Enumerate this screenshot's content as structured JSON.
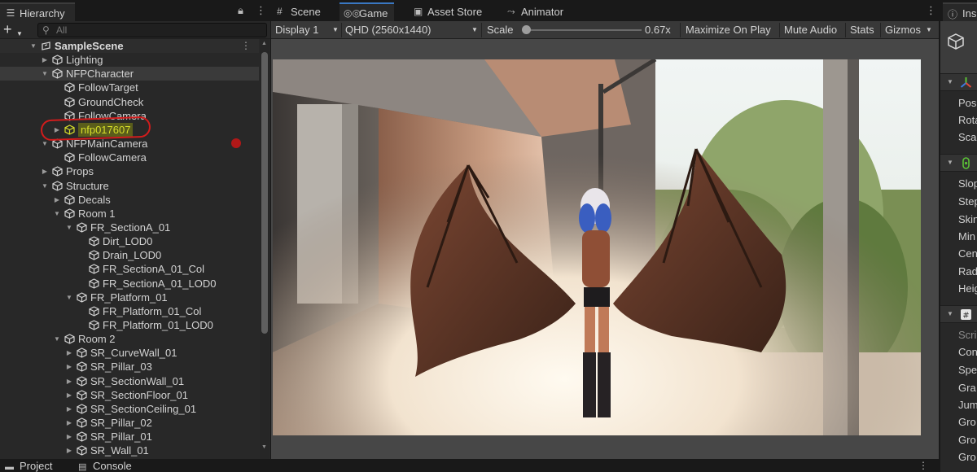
{
  "hierarchy": {
    "tab_label": "Hierarchy",
    "search_placeholder": "All",
    "lock_icon": "lock-icon",
    "menu_icon": "kebab-menu-icon",
    "rows": [
      {
        "label": "SampleScene",
        "depth": 0,
        "arrow": "open",
        "kind": "scene"
      },
      {
        "label": "Lighting",
        "depth": 1,
        "arrow": "closed",
        "kind": "object"
      },
      {
        "label": "NFPCharacter",
        "depth": 1,
        "arrow": "open",
        "kind": "object"
      },
      {
        "label": "FollowTarget",
        "depth": 2,
        "arrow": "none",
        "kind": "object"
      },
      {
        "label": "GroundCheck",
        "depth": 2,
        "arrow": "none",
        "kind": "object"
      },
      {
        "label": "FollowCamera",
        "depth": 2,
        "arrow": "none",
        "kind": "object"
      },
      {
        "label": "nfp017607",
        "depth": 2,
        "arrow": "closed",
        "kind": "prefab"
      },
      {
        "label": "NFPMainCamera",
        "depth": 1,
        "arrow": "open",
        "kind": "object"
      },
      {
        "label": "FollowCamera",
        "depth": 2,
        "arrow": "none",
        "kind": "object"
      },
      {
        "label": "Props",
        "depth": 1,
        "arrow": "closed",
        "kind": "object"
      },
      {
        "label": "Structure",
        "depth": 1,
        "arrow": "open",
        "kind": "object"
      },
      {
        "label": "Decals",
        "depth": 2,
        "arrow": "closed",
        "kind": "object"
      },
      {
        "label": "Room 1",
        "depth": 2,
        "arrow": "open",
        "kind": "object"
      },
      {
        "label": "FR_SectionA_01",
        "depth": 3,
        "arrow": "open",
        "kind": "object"
      },
      {
        "label": "Dirt_LOD0",
        "depth": 4,
        "arrow": "none",
        "kind": "object"
      },
      {
        "label": "Drain_LOD0",
        "depth": 4,
        "arrow": "none",
        "kind": "object"
      },
      {
        "label": "FR_SectionA_01_Col",
        "depth": 4,
        "arrow": "none",
        "kind": "object"
      },
      {
        "label": "FR_SectionA_01_LOD0",
        "depth": 4,
        "arrow": "none",
        "kind": "object"
      },
      {
        "label": "FR_Platform_01",
        "depth": 3,
        "arrow": "open",
        "kind": "object"
      },
      {
        "label": "FR_Platform_01_Col",
        "depth": 4,
        "arrow": "none",
        "kind": "object"
      },
      {
        "label": "FR_Platform_01_LOD0",
        "depth": 4,
        "arrow": "none",
        "kind": "object"
      },
      {
        "label": "Room 2",
        "depth": 2,
        "arrow": "open",
        "kind": "object"
      },
      {
        "label": "SR_CurveWall_01",
        "depth": 3,
        "arrow": "closed",
        "kind": "object"
      },
      {
        "label": "SR_Pillar_03",
        "depth": 3,
        "arrow": "closed",
        "kind": "object"
      },
      {
        "label": "SR_SectionWall_01",
        "depth": 3,
        "arrow": "closed",
        "kind": "object"
      },
      {
        "label": "SR_SectionFloor_01",
        "depth": 3,
        "arrow": "closed",
        "kind": "object"
      },
      {
        "label": "SR_SectionCeiling_01",
        "depth": 3,
        "arrow": "closed",
        "kind": "object"
      },
      {
        "label": "SR_Pillar_02",
        "depth": 3,
        "arrow": "closed",
        "kind": "object"
      },
      {
        "label": "SR_Pillar_01",
        "depth": 3,
        "arrow": "closed",
        "kind": "object"
      },
      {
        "label": "SR_Wall_01",
        "depth": 3,
        "arrow": "closed",
        "kind": "object"
      }
    ]
  },
  "game": {
    "tabs": [
      {
        "label": "Scene",
        "icon": "grid-icon",
        "active": false
      },
      {
        "label": "Game",
        "icon": "gamepad-icon",
        "active": true
      },
      {
        "label": "Asset Store",
        "icon": "shopping-bag-icon",
        "active": false
      },
      {
        "label": "Animator",
        "icon": "animator-icon",
        "active": false
      }
    ],
    "toolbar": {
      "display": "Display 1",
      "resolution": "QHD (2560x1440)",
      "scale_label": "Scale",
      "scale_value": "0.67x",
      "maximize": "Maximize On Play",
      "mute": "Mute Audio",
      "stats": "Stats",
      "gizmos": "Gizmos"
    }
  },
  "inspector": {
    "tab_label": "Ins",
    "sections": [
      {
        "icon": "transform-icon",
        "props": [
          "Pos",
          "Rota",
          "Sca"
        ]
      },
      {
        "icon": "capsule-collider-icon",
        "props": [
          "Slop",
          "Step",
          "Skin",
          "Min",
          "Cen",
          "Rad",
          "Heig"
        ]
      },
      {
        "icon": "script-icon",
        "props": [
          "Scri",
          "Con",
          "Spe",
          "Gra",
          "Jum",
          "Gro",
          "Gro",
          "Gro"
        ]
      }
    ]
  },
  "bottom": {
    "tabs": [
      {
        "label": "Project",
        "icon": "folder-icon"
      },
      {
        "label": "Console",
        "icon": "console-icon"
      }
    ]
  },
  "colors": {
    "panel_bg": "#282828",
    "toolbar_bg": "#383838",
    "active_tab_accent": "#3a78c2",
    "highlight_text": "#d7df2a",
    "annotation_red": "#d21c1c"
  }
}
